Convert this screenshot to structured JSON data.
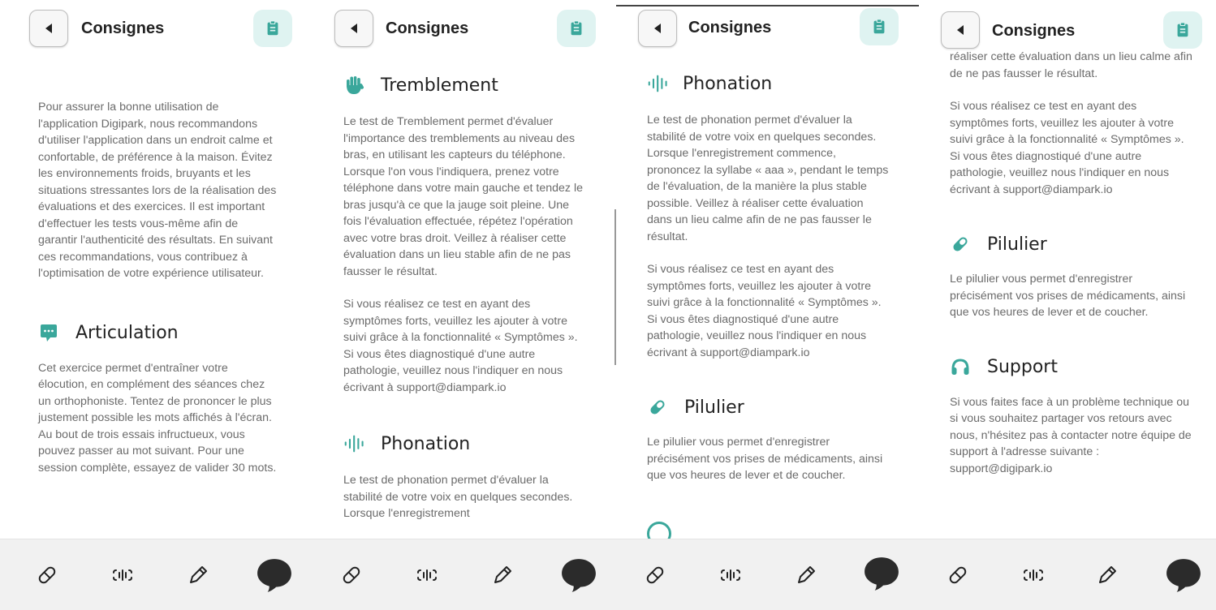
{
  "app": {
    "header_title": "Consignes",
    "accent_color": "#3aa79b",
    "icon_bg_color": "#dff3f1"
  },
  "icons": {
    "back": "back-triangle-icon",
    "clipboard": "clipboard-icon",
    "tremblement": "hand-icon",
    "phonation": "soundwave-icon",
    "articulation": "chat-bubble-icon",
    "pilulier": "pill-icon",
    "support": "headset-icon"
  },
  "nav": [
    {
      "name": "pill-nav-icon"
    },
    {
      "name": "voice-nav-icon"
    },
    {
      "name": "pencil-nav-icon"
    },
    {
      "name": "chat-nav-icon"
    }
  ],
  "panel1": {
    "intro": "Pour assurer la bonne utilisation de l'application Digipark, nous recommandons d'utiliser l'application dans un endroit calme et confortable, de préférence à la maison. Évitez les environnements froids, bruyants et les situations stressantes lors de la réalisation des évaluations et des exercices. Il est important d'effectuer les tests vous-même afin de garantir l'authenticité des résultats. En suivant ces recommandations, vous contribuez à l'optimisation de votre expérience utilisateur.",
    "articulation_title": "Articulation",
    "articulation_text": "Cet exercice permet d'entraîner votre élocution, en complément des séances chez un orthophoniste. Tentez de prononcer le plus justement possible les mots affichés à l'écran. Au bout de trois essais infructueux, vous pouvez passer au mot suivant. Pour une session complète, essayez de valider 30 mots."
  },
  "panel2": {
    "tremblement_title": "Tremblement",
    "tremblement_text": "Le test de Tremblement permet d'évaluer l'importance des tremblements au niveau des bras, en utilisant les capteurs du téléphone. Lorsque l'on vous l'indiquera, prenez votre téléphone dans votre main gauche et tendez le bras jusqu'à ce que la jauge soit pleine. Une fois l'évaluation effectuée, répétez l'opération avec votre bras droit. Veillez à réaliser cette évaluation dans un lieu stable afin de ne pas fausser le résultat.",
    "symptomes_text": "Si vous réalisez ce test en ayant des symptômes forts, veuillez les ajouter à votre suivi grâce à la fonctionnalité « Symptômes ». Si vous êtes diagnostiqué d'une autre pathologie, veuillez nous l'indiquer en nous écrivant à support@diampark.io",
    "phonation_title": "Phonation",
    "phonation_text": "Le test de phonation permet d'évaluer la stabilité de votre voix en quelques secondes. Lorsque l'enregistrement"
  },
  "panel3": {
    "phonation_title": "Phonation",
    "phonation_text": "Le test de phonation permet d'évaluer la stabilité de votre voix en quelques secondes. Lorsque l'enregistrement commence, prononcez la syllabe « aaa », pendant le temps de l'évaluation, de la manière la plus stable possible. Veillez à réaliser cette évaluation dans un lieu calme afin de ne pas fausser le résultat.",
    "symptomes_text": "Si vous réalisez ce test en ayant des symptômes forts, veuillez les ajouter à votre suivi grâce à la fonctionnalité « Symptômes ». Si vous êtes diagnostiqué d'une autre pathologie, veuillez nous l'indiquer en nous écrivant à support@diampark.io",
    "pilulier_title": "Pilulier",
    "pilulier_text": "Le pilulier vous permet d'enregistrer précisément vos prises de médicaments, ainsi que vos heures de lever et de coucher."
  },
  "panel4": {
    "top_text": "réaliser cette évaluation dans un lieu calme afin de ne pas fausser le résultat.",
    "symptomes_text": "Si vous réalisez ce test en ayant des symptômes forts, veuillez les ajouter à votre suivi grâce à la fonctionnalité « Symptômes ». Si vous êtes diagnostiqué d'une autre pathologie, veuillez nous l'indiquer en nous écrivant à support@diampark.io",
    "pilulier_title": "Pilulier",
    "pilulier_text": "Le pilulier vous permet d'enregistrer précisément vos prises de médicaments, ainsi que vos heures de lever et de coucher.",
    "support_title": "Support",
    "support_text": "Si vous faites face à un problème technique ou si vous souhaitez partager vos retours avec nous, n'hésitez pas à contacter notre équipe de support à l'adresse suivante : support@digipark.io"
  }
}
